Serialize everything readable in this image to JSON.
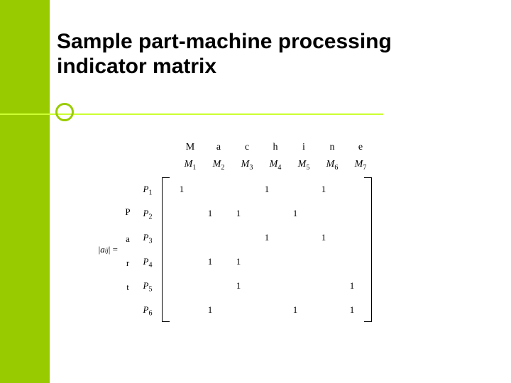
{
  "title": "Sample part-machine processing indicator matrix",
  "word_top": {
    "c0": "",
    "c1": "M",
    "c2": "a",
    "c3": "c",
    "c4": "h",
    "c5": "i",
    "c6": "n",
    "c7": "e"
  },
  "machine_headers": {
    "m1": "M",
    "m2": "M",
    "m3": "M",
    "m4": "M",
    "m5": "M",
    "m6": "M",
    "m7": "M",
    "s1": "1",
    "s2": "2",
    "s3": "3",
    "s4": "4",
    "s5": "5",
    "s6": "6",
    "s7": "7"
  },
  "lhs": {
    "bar_open": "|",
    "a": "a",
    "ij": "ij",
    "bar_close": "|",
    "eq": " = "
  },
  "vword": {
    "l1": "P",
    "l2": "a",
    "l3": "r",
    "l4": "t"
  },
  "row_labels": {
    "p1": "P",
    "p2": "P",
    "p3": "P",
    "p4": "P",
    "p5": "P",
    "p6": "P",
    "s1": "1",
    "s2": "2",
    "s3": "3",
    "s4": "4",
    "s5": "5",
    "s6": "6"
  },
  "matrix": {
    "r1": {
      "c1": "1",
      "c2": "",
      "c3": "",
      "c4": "1",
      "c5": "",
      "c6": "1",
      "c7": ""
    },
    "r2": {
      "c1": "",
      "c2": "1",
      "c3": "1",
      "c4": "",
      "c5": "1",
      "c6": "",
      "c7": ""
    },
    "r3": {
      "c1": "",
      "c2": "",
      "c3": "",
      "c4": "1",
      "c5": "",
      "c6": "1",
      "c7": ""
    },
    "r4": {
      "c1": "",
      "c2": "1",
      "c3": "1",
      "c4": "",
      "c5": "",
      "c6": "",
      "c7": ""
    },
    "r5": {
      "c1": "",
      "c2": "",
      "c3": "1",
      "c4": "",
      "c5": "",
      "c6": "",
      "c7": "1"
    },
    "r6": {
      "c1": "",
      "c2": "1",
      "c3": "",
      "c4": "",
      "c5": "1",
      "c6": "",
      "c7": "1"
    }
  }
}
